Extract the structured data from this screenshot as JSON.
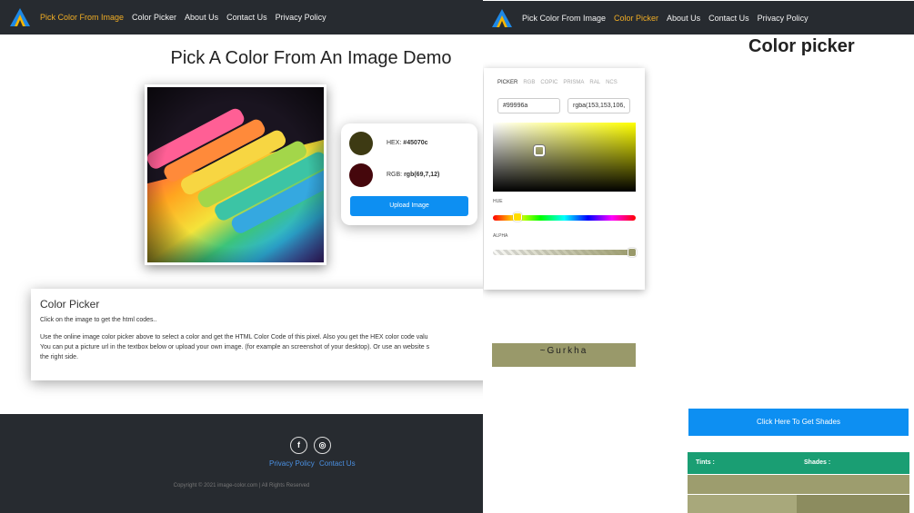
{
  "left": {
    "nav": {
      "items": [
        "Pick Color From Image",
        "Color Picker",
        "About Us",
        "Contact Us",
        "Privacy Policy"
      ],
      "active_index": 0
    },
    "page_title": "Pick A Color From An Image Demo",
    "result": {
      "hex_label": "HEX:",
      "hex_value": "#45070c",
      "hex_swatch_color": "#3d3a13",
      "rgb_label": "RGB:",
      "rgb_value": "rgb(69,7,12)",
      "rgb_swatch_color": "#45070c",
      "upload_label": "Upload Image"
    },
    "info": {
      "title": "Color Picker",
      "line1": "Click on the image to get the html codes..",
      "para2_line1": "Use the online image color picker above to select a color and get the HTML Color Code of this pixel. Also you get the HEX color code valu",
      "para2_line2": "You can put a picture url in the textbox below or upload your own image. (for example an screenshot of your desktop). Or use an website s",
      "para2_line3": "the right side."
    },
    "footer": {
      "facebook_glyph": "f",
      "instagram_glyph": "◎",
      "links": [
        "Privacy Policy",
        "Contact Us"
      ],
      "copyright": "Copyright © 2021 image-color.com | All Rights Reserved"
    }
  },
  "right": {
    "nav": {
      "items": [
        "Pick Color From Image",
        "Color Picker",
        "About Us",
        "Contact Us",
        "Privacy Policy"
      ],
      "active_index": 1
    },
    "page_title": "Color picker",
    "picker": {
      "tabs": [
        "PICKER",
        "RGB",
        "COPIC",
        "PRISMA",
        "RAL",
        "NCS"
      ],
      "active_tab": 0,
      "hex_value": "#99996a",
      "rgba_value": "rgba(153,153,106,1)",
      "hue_label": "HUE",
      "alpha_label": "ALPHA",
      "selected_color": "#99996a",
      "saturation": 0.31,
      "brightness": 0.6,
      "hue_deg": 60,
      "alpha": 1
    },
    "color_name": "~Gurkha",
    "shades_button": "Click Here To Get Shades",
    "table": {
      "tints_label": "Tints :",
      "shades_label": "Shades :",
      "header_color": "#1a9e73"
    }
  },
  "colors": {
    "nav_bg": "#272b30",
    "nav_active": "#f0ad25",
    "accent_blue": "#0d8ff2",
    "gurkha": "#99996a"
  }
}
